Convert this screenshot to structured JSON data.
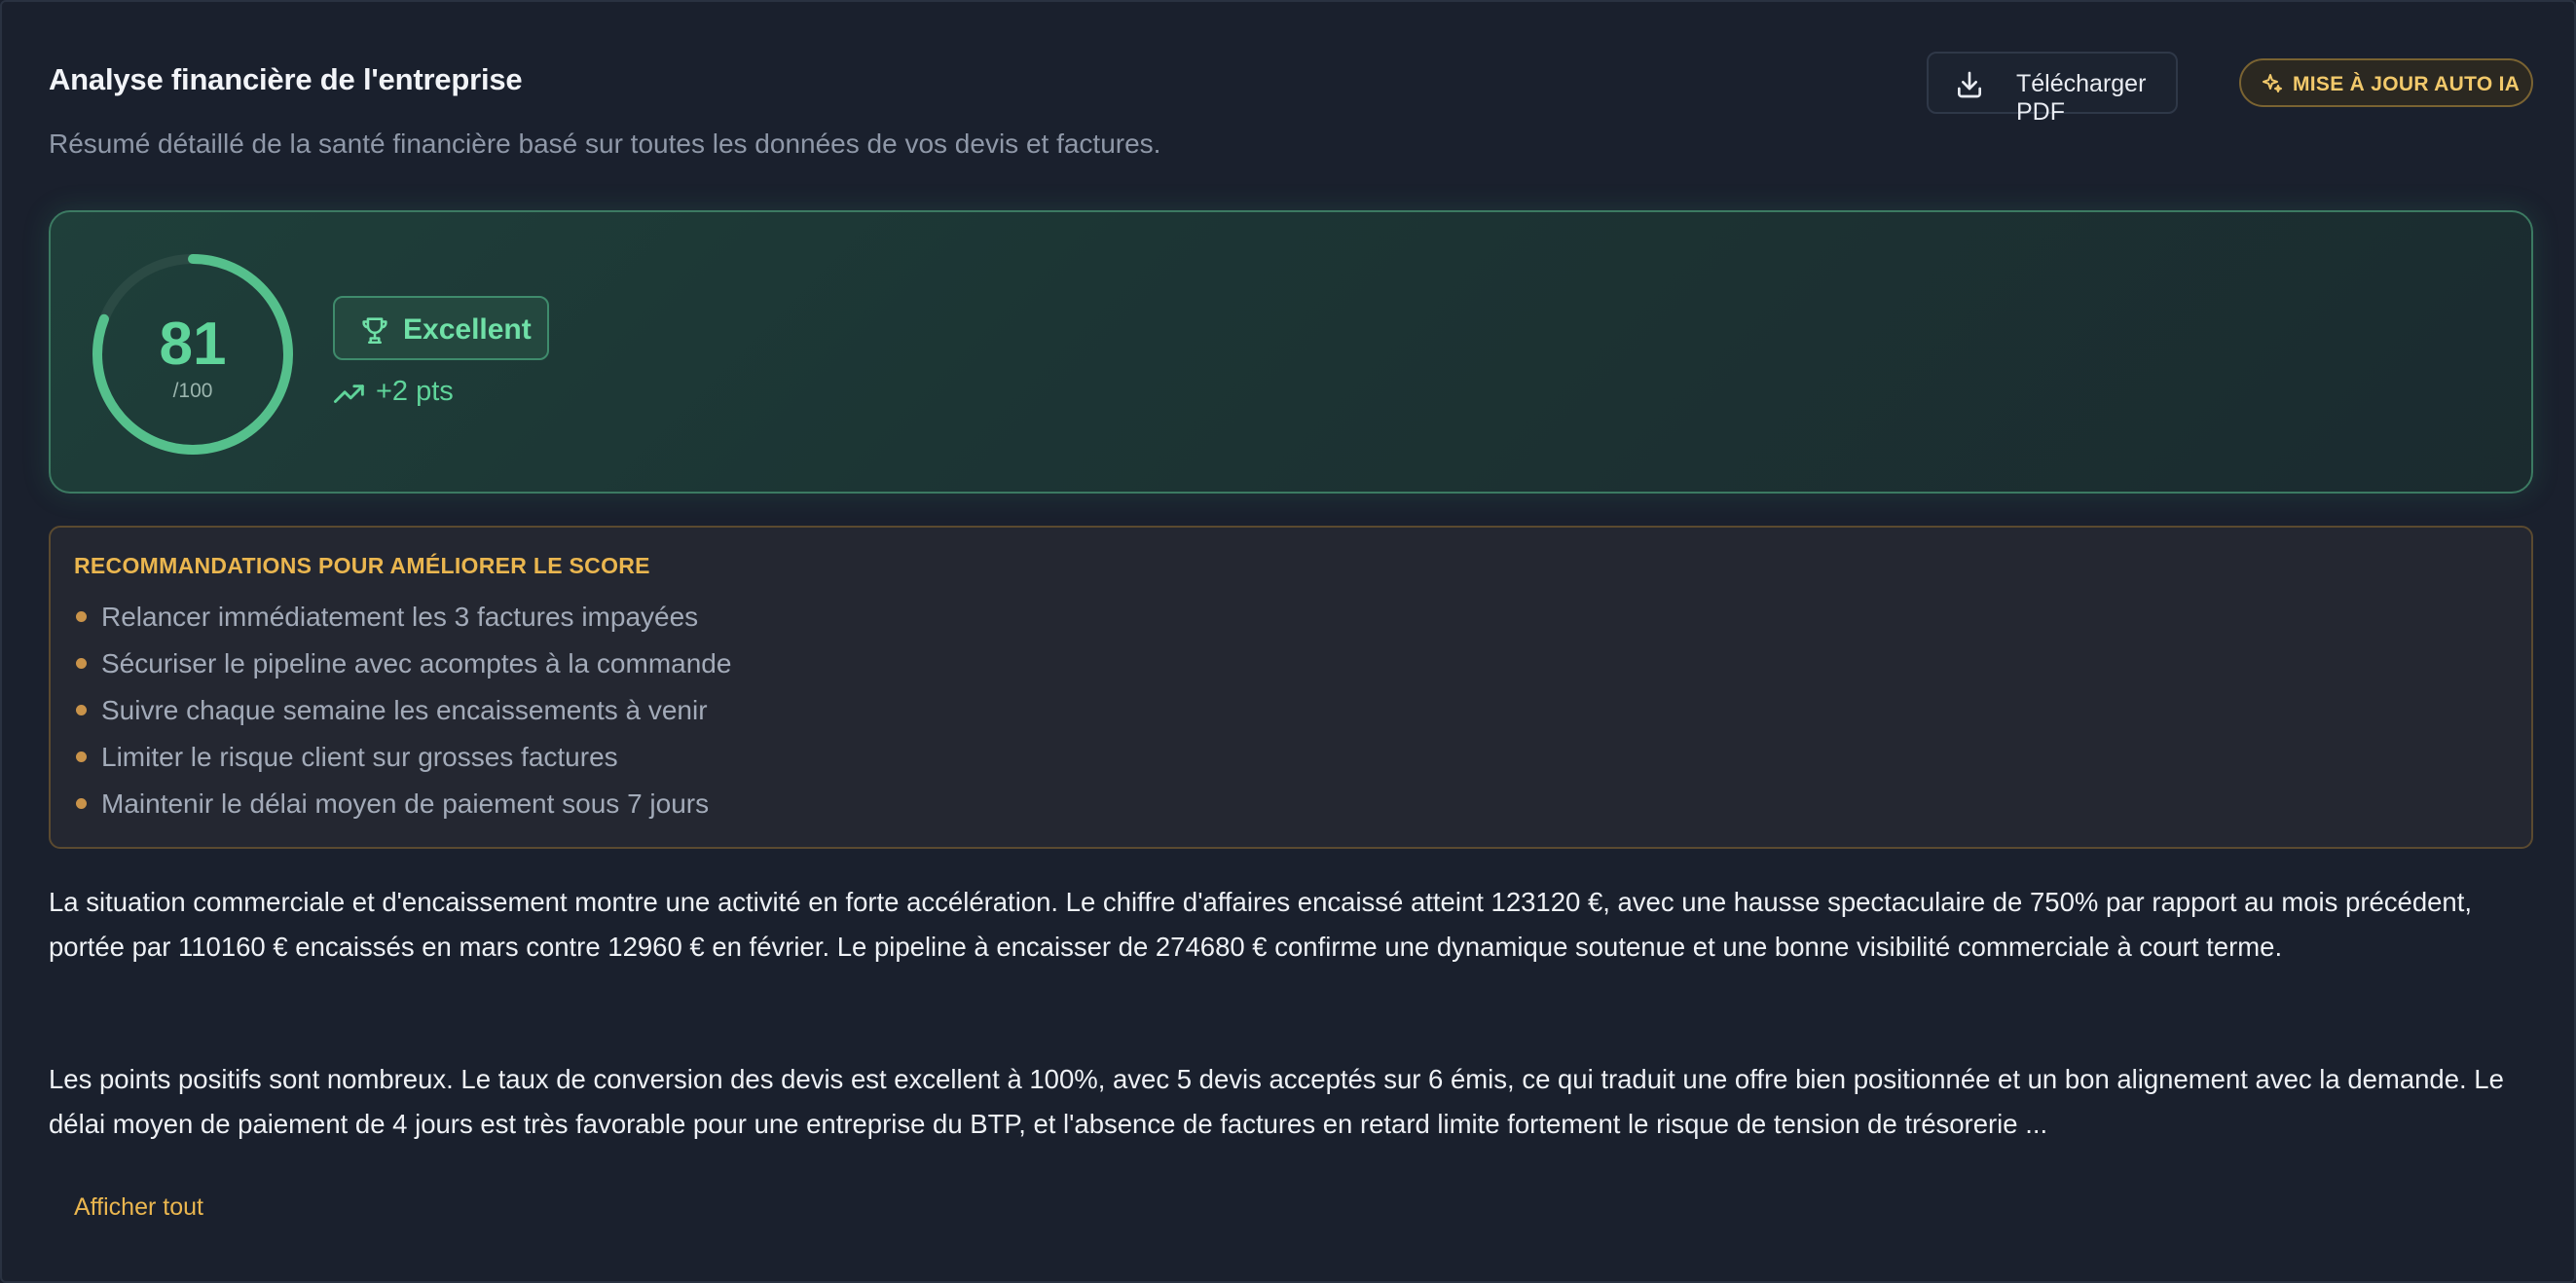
{
  "header": {
    "title": "Analyse financière de l'entreprise",
    "subtitle": "Résumé détaillé de la santé financière basé sur toutes les données de vos devis et factures.",
    "download_label": "Télécharger PDF",
    "ai_update_label": "MISE À JOUR AUTO IA"
  },
  "score": {
    "value": "81",
    "max": "/100",
    "progress_fraction": 0.81,
    "rating": "Excellent",
    "trend": "+2 pts"
  },
  "recommendations": {
    "title": "RECOMMANDATIONS POUR AMÉLIORER LE SCORE",
    "items": [
      "Relancer immédiatement les 3 factures impayées",
      "Sécuriser le pipeline avec acomptes à la commande",
      "Suivre chaque semaine les encaissements à venir",
      "Limiter le risque client sur grosses factures",
      "Maintenir le délai moyen de paiement sous 7 jours"
    ]
  },
  "analysis": {
    "paragraph_1": "La situation commerciale et d'encaissement montre une activité en forte accélération. Le chiffre d'affaires encaissé atteint 123120 €, avec une hausse spectaculaire de 750% par rapport au mois précédent, portée par 110160 € encaissés en mars contre 12960 € en février. Le pipeline à encaisser de 274680 € confirme une dynamique soutenue et une bonne visibilité commerciale à court terme.",
    "paragraph_2": "Les points positifs sont nombreux. Le taux de conversion des devis est excellent à 100%, avec 5 devis acceptés sur 6 émis, ce qui traduit une offre bien positionnée et un bon alignement avec la demande. Le délai moyen de paiement de 4 jours est très favorable pour une entreprise du BTP, et l'absence de factures en retard limite fortement le risque de tension de trésorerie ...",
    "show_all_label": "Afficher tout"
  },
  "colors": {
    "background": "#1a202d",
    "score_green": "#5fd49a",
    "accent_gold": "#eab64f",
    "bullet": "#c9934a"
  },
  "icons": {
    "download": "download-icon",
    "ai": "sparkles-icon",
    "rating": "trophy-icon",
    "trend": "trending-up-icon"
  }
}
